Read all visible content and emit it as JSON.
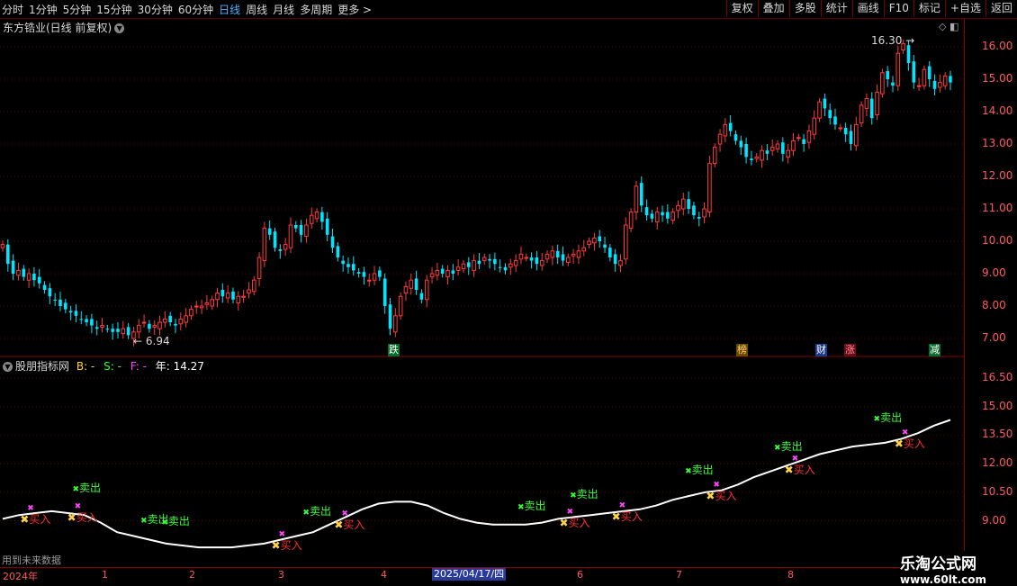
{
  "toolbar": {
    "tabs": [
      "分时",
      "1分钟",
      "5分钟",
      "15分钟",
      "30分钟",
      "60分钟",
      "日线",
      "周线",
      "月线",
      "多周期",
      "更多 >"
    ],
    "active_tab": "日线",
    "right_buttons": [
      "复权",
      "叠加",
      "多股",
      "统计",
      "画线",
      "F10",
      "标记",
      "+自选",
      "返回"
    ]
  },
  "chart_header": {
    "title": "东方锆业(日线 前复权)"
  },
  "price_axis": [
    "16.00",
    "15.00",
    "14.00",
    "13.00",
    "12.00",
    "11.00",
    "10.00",
    "9.00",
    "8.00",
    "7.00"
  ],
  "annotations": {
    "high": "16.30",
    "low": "6.94"
  },
  "event_tags": [
    "跌",
    "榜",
    "财",
    "涨",
    "减"
  ],
  "indicator": {
    "name": "股朋指标网",
    "b": "B: -",
    "s": "S: -",
    "f": "F: -",
    "year": "年: 14.27",
    "axis": [
      "16.50",
      "15.00",
      "13.50",
      "12.00",
      "10.50",
      "9.00"
    ]
  },
  "signals": {
    "buy": "买入",
    "sell": "卖出"
  },
  "time_axis": {
    "year": "2024年",
    "months": [
      "1",
      "2",
      "3",
      "4",
      "6",
      "7",
      "8"
    ],
    "cursor_date": "2025/04/17/四"
  },
  "footer_note": "用到未来数据",
  "watermark": {
    "line1": "乐淘公式网",
    "line2": "www.60lt.com"
  },
  "colors": {
    "up": "#ff3b3b",
    "down": "#00e5ff",
    "buy": "#ff3030",
    "sell": "#33ff33",
    "mid": "#ff44ff",
    "line": "#ffffff",
    "axis": "#8b0000"
  },
  "chart_data": {
    "type": "candlestick",
    "title": "东方锆业(日线 前复权)",
    "ylim": [
      6.6,
      16.6
    ],
    "closes": [
      9.9,
      9.3,
      9.0,
      9.1,
      8.9,
      9.0,
      8.8,
      8.7,
      8.5,
      8.3,
      8.2,
      8.0,
      7.9,
      7.8,
      7.7,
      7.6,
      7.5,
      7.4,
      7.3,
      7.4,
      7.3,
      7.2,
      7.2,
      7.3,
      7.1,
      7.2,
      7.4,
      7.5,
      7.3,
      7.4,
      7.5,
      7.6,
      7.5,
      7.4,
      7.6,
      7.7,
      7.9,
      8.0,
      8.0,
      8.1,
      8.2,
      8.4,
      8.3,
      8.4,
      8.2,
      8.3,
      8.3,
      8.5,
      8.8,
      9.5,
      10.4,
      10.2,
      9.8,
      9.7,
      9.9,
      10.5,
      10.4,
      10.2,
      10.5,
      10.8,
      10.9,
      10.6,
      10.2,
      9.8,
      9.5,
      9.3,
      9.2,
      9.1,
      9.0,
      8.9,
      8.8,
      9.0,
      8.9,
      8.0,
      7.3,
      7.7,
      8.3,
      8.6,
      8.8,
      8.5,
      8.2,
      8.8,
      9.0,
      9.1,
      9.0,
      9.1,
      9.0,
      9.2,
      9.3,
      9.2,
      9.4,
      9.3,
      9.5,
      9.4,
      9.3,
      9.2,
      9.1,
      9.3,
      9.4,
      9.6,
      9.5,
      9.4,
      9.3,
      9.4,
      9.6,
      9.7,
      9.5,
      9.4,
      9.5,
      9.6,
      9.7,
      9.8,
      10.0,
      10.1,
      10.0,
      9.8,
      9.5,
      9.3,
      9.4,
      10.5,
      10.9,
      11.7,
      11.1,
      10.8,
      10.7,
      10.9,
      10.8,
      10.7,
      10.9,
      11.1,
      11.3,
      11.0,
      10.8,
      10.7,
      11.0,
      12.4,
      12.9,
      13.3,
      13.6,
      13.4,
      13.1,
      12.9,
      12.6,
      12.5,
      12.6,
      12.8,
      12.7,
      12.9,
      13.0,
      12.7,
      12.8,
      13.1,
      13.2,
      13.0,
      13.4,
      13.8,
      14.3,
      14.1,
      13.8,
      13.6,
      13.5,
      13.3,
      13.0,
      13.6,
      14.2,
      14.4,
      13.8,
      14.6,
      15.2,
      15.0,
      14.8,
      15.8,
      16.1,
      15.5,
      14.9,
      14.8,
      15.3,
      15.0,
      14.7,
      14.9,
      15.1,
      14.9
    ],
    "ind_axis": [
      9.0,
      16.5
    ],
    "ind_line": [
      9.1,
      9.3,
      9.4,
      9.5,
      9.4,
      9.3,
      8.9,
      8.4,
      8.2,
      8.0,
      7.8,
      7.7,
      7.6,
      7.6,
      7.6,
      7.7,
      7.8,
      8.0,
      8.2,
      8.4,
      8.8,
      9.2,
      9.6,
      9.9,
      10.0,
      10.0,
      9.8,
      9.4,
      9.1,
      8.9,
      8.8,
      8.8,
      8.8,
      8.9,
      9.1,
      9.2,
      9.3,
      9.4,
      9.5,
      9.6,
      9.8,
      10.1,
      10.3,
      10.5,
      10.6,
      10.9,
      11.3,
      11.6,
      11.9,
      12.2,
      12.5,
      12.7,
      12.9,
      13.0,
      13.1,
      13.3,
      13.6,
      14.0,
      14.3
    ],
    "buy_x": [
      4,
      13,
      52,
      64,
      107,
      117,
      135,
      150,
      171
    ],
    "sell_x": [
      14,
      27,
      31,
      58,
      99,
      109,
      131,
      148,
      167
    ]
  }
}
